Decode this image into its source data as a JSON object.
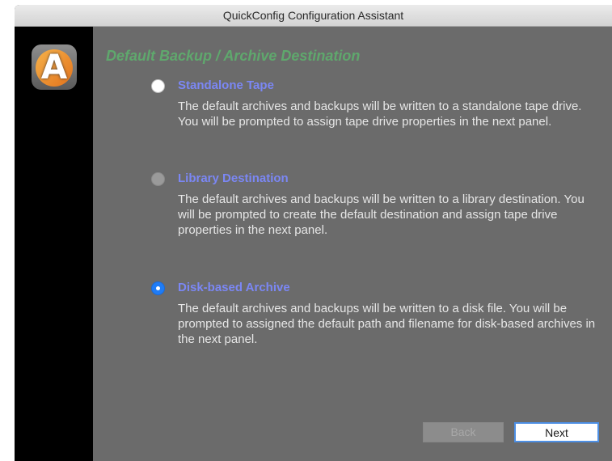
{
  "window": {
    "title": "QuickConfig Configuration Assistant"
  },
  "logo": {
    "letter": "A"
  },
  "heading": "Default Backup / Archive Destination",
  "options": [
    {
      "label": "Standalone Tape",
      "state": "unselected",
      "description": "The default archives and backups will be written to a standalone tape drive.  You will be prompted to assign tape drive properties in the next panel."
    },
    {
      "label": "Library Destination",
      "state": "disabled",
      "description": "The default archives and backups will be written to a library destination.  You will be prompted to create the default destination and assign tape drive properties in the next panel."
    },
    {
      "label": "Disk-based Archive",
      "state": "selected",
      "description": "The default archives and backups will be written to a disk file.  You will be prompted to assigned the default path and filename for disk-based archives in the next panel."
    }
  ],
  "buttons": {
    "back_label": "Back",
    "back_enabled": false,
    "next_label": "Next",
    "next_enabled": true
  },
  "colors": {
    "panel_background": "#6b6b6b",
    "sidebar": "#000000",
    "heading": "#5fa86d",
    "option_label": "#7b87f4",
    "selected_radio": "#1f7cf6"
  }
}
